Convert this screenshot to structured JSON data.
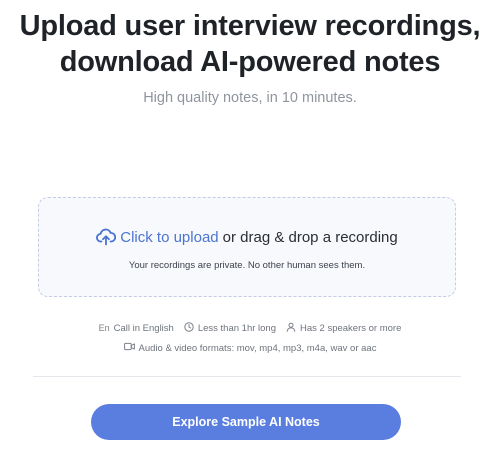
{
  "hero": {
    "title_line1": "Upload user interview recordings,",
    "title_line2": "download AI-powered notes",
    "subtitle": "High quality notes, in 10 minutes."
  },
  "dropzone": {
    "upload_icon": "cloud-upload-icon",
    "link_text": "Click to upload",
    "rest_text": "or drag & drop a recording",
    "privacy_note": "Your recordings are private. No other human sees them."
  },
  "requirements": {
    "language": {
      "icon": "language-icon",
      "label": "Call in English"
    },
    "length": {
      "icon": "clock-icon",
      "label": "Less than 1hr long"
    },
    "speakers": {
      "icon": "user-icon",
      "label": "Has 2 speakers or more"
    },
    "formats": {
      "icon": "video-camera-icon",
      "label": "Audio & video formats: mov, mp4, mp3, m4a, wav or aac"
    }
  },
  "cta": {
    "label": "Explore Sample AI Notes"
  },
  "colors": {
    "accent": "#5a7de0",
    "link": "#4a74d1",
    "dropzone_bg": "#f8f9fc",
    "dropzone_border": "#c5cbe6"
  }
}
